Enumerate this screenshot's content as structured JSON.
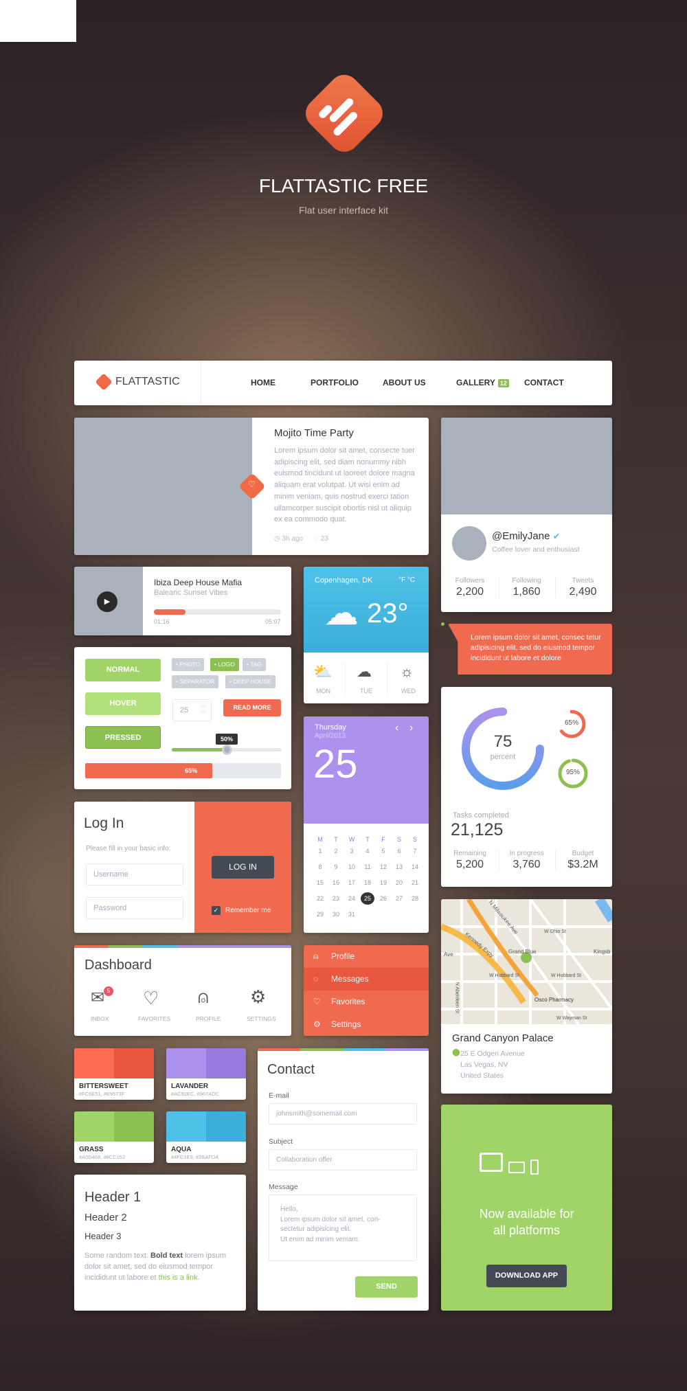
{
  "hero": {
    "title": "FLATTASTIC FREE",
    "subtitle": "Flat user interface kit"
  },
  "nav": {
    "brand": "FLATTASTIC",
    "items": [
      "HOME",
      "PORTFOLIO",
      "ABOUT US",
      "GALLERY",
      "CONTACT"
    ],
    "gallery_badge": "12"
  },
  "post": {
    "title": "Mojito Time Party",
    "body": "Lorem ipsum dolor sit amet, consecte tuer adipiscing elit, sed diam nonummy nibh euismod tincidunt ut laoreet dolore magna aliquam erat volutpat. Ut wisi enim ad minim veniam, quis nostrud exerci tation ullamcorper suscipit obortis nisl ut aliquip ex ea commodo quat.",
    "time": "3h ago",
    "comments": "23"
  },
  "profile": {
    "handle": "@EmilyJane",
    "bio": "Coffee lover and enthusiast",
    "stats": [
      {
        "label": "Followers",
        "value": "2,200"
      },
      {
        "label": "Following",
        "value": "1,860"
      },
      {
        "label": "Tweets",
        "value": "2,490"
      }
    ]
  },
  "player": {
    "title": "Ibiza Deep House Mafia",
    "subtitle": "Balearic Sunset Vibes",
    "elapsed": "01:16",
    "total": "05:07",
    "progress": 0.25
  },
  "weather": {
    "city": "Copenhagen, DK",
    "units": "°F °C",
    "temp": "23°",
    "days": [
      "MON",
      "TUE",
      "WED"
    ]
  },
  "tooltip": {
    "text": "Lorem ipsum dolor sit amet, consec tetur adipisicing elit, sed do eiusmod tempor incididunt ut labore et dolore"
  },
  "controls": {
    "buttons": [
      "NORMAL",
      "HOVER",
      "PRESSED"
    ],
    "tags": [
      "• PHOTO",
      "• LOGO",
      "• TAG",
      "• SEPARATOR",
      "• DEEP HOUSE"
    ],
    "stepper_value": "25",
    "read_more": "READ MORE",
    "slider_label": "50%",
    "slider_value": 0.5,
    "progress_label": "65%",
    "progress_value": 0.65
  },
  "calendar": {
    "weekday": "Thursday",
    "month": "April/2013",
    "day": "25",
    "headers": [
      "M",
      "T",
      "W",
      "T",
      "F",
      "S",
      "S"
    ],
    "days": [
      "1",
      "2",
      "3",
      "4",
      "5",
      "6",
      "7",
      "8",
      "9",
      "10",
      "11",
      "12",
      "13",
      "14",
      "15",
      "16",
      "17",
      "18",
      "19",
      "20",
      "21",
      "22",
      "23",
      "24",
      "25",
      "26",
      "27",
      "28",
      "29",
      "30",
      "31"
    ],
    "selected": "25"
  },
  "stats": {
    "main_value": "75",
    "main_label": "percent",
    "small1": "65%",
    "small2": "95%",
    "tasks_label": "Tasks completed",
    "tasks_value": "21,125",
    "items": [
      {
        "label": "Remaining",
        "value": "5,200"
      },
      {
        "label": "In progress",
        "value": "3,760"
      },
      {
        "label": "Budget",
        "value": "$3.2M"
      }
    ]
  },
  "login": {
    "title": "Log In",
    "hint": "Please fill in your basic info:",
    "username_ph": "Username",
    "password_ph": "Password",
    "button": "LOG IN",
    "remember": "Remember me"
  },
  "map": {
    "labels": [
      "N Milwaukee Ave",
      "Kennedy Expy",
      "Grand Blue",
      "W Hubbard St",
      "W Hubbard St",
      "Osco Pharmacy",
      "W Wayman St",
      "N Aberdeen St",
      "W Ohio St",
      "Ave",
      "Kingsb"
    ],
    "place": "Grand Canyon Palace",
    "address": [
      "25 E Odgen Avenue",
      "Las Vegas, NV",
      "United States"
    ]
  },
  "dashboard": {
    "title": "Dashboard",
    "items": [
      "INBOX",
      "FAVORITES",
      "PROFILE",
      "SETTINGS"
    ],
    "inbox_badge": "5"
  },
  "menu": {
    "items": [
      "Profile",
      "Messages",
      "Favorites",
      "Settings"
    ],
    "active": "Messages"
  },
  "swatches": [
    {
      "name": "BITTERSWEET",
      "hex": "#FC6E51, #E9573F",
      "c1": "#fc6e51",
      "c2": "#e9573f"
    },
    {
      "name": "LAVANDER",
      "hex": "#AC92EC, #967ADC",
      "c1": "#ac92ec",
      "c2": "#967adc"
    },
    {
      "name": "GRASS",
      "hex": "#A0D468, #8CC152",
      "c1": "#a0d468",
      "c2": "#8cc152"
    },
    {
      "name": "AQUA",
      "hex": "#4FC1E9, #3BAFDA",
      "c1": "#4fc1e9",
      "c2": "#3bafda"
    }
  ],
  "typography": {
    "h1": "Header 1",
    "h2": "Header 2",
    "h3": "Header 3",
    "text_before": "Some random text. ",
    "bold": "Bold text",
    "text_mid": " lorem ipsum dolor sit amet, sed do eiusmod tempor incididunt ut labore et ",
    "link": "this is a link."
  },
  "contact": {
    "title": "Contact",
    "email_label": "E-mail",
    "email_ph": "johnsmith@somemail.com",
    "subject_label": "Subject",
    "subject_ph": "Collaboration offer",
    "message_label": "Message",
    "message_lines": [
      "Hello,",
      "Lorem ipsum dolor sit amet, con-",
      "sectetur adipisicing elit.",
      "Ut enim ad minim veniam."
    ],
    "send": "SEND"
  },
  "promo": {
    "line1": "Now available for",
    "line2": "all platforms",
    "button": "DOWNLOAD APP"
  }
}
